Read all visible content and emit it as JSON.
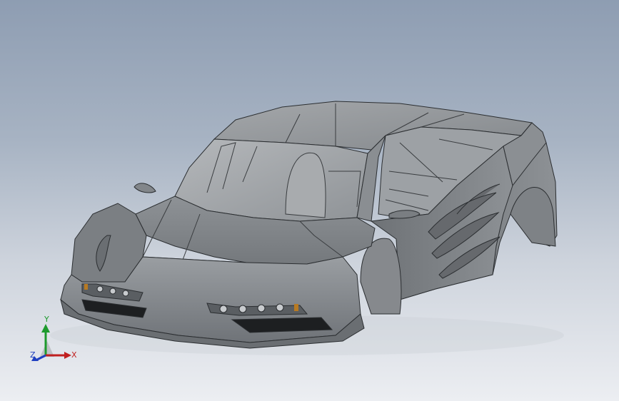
{
  "viewport": {
    "background_top": "#8e9db2",
    "background_bottom": "#eceef2",
    "model_color": "#7d8185"
  },
  "triad": {
    "x_label": "X",
    "y_label": "Y",
    "z_label": "Z",
    "x_color": "#c02020",
    "y_color": "#1d9a2d",
    "z_color": "#2040c0"
  }
}
